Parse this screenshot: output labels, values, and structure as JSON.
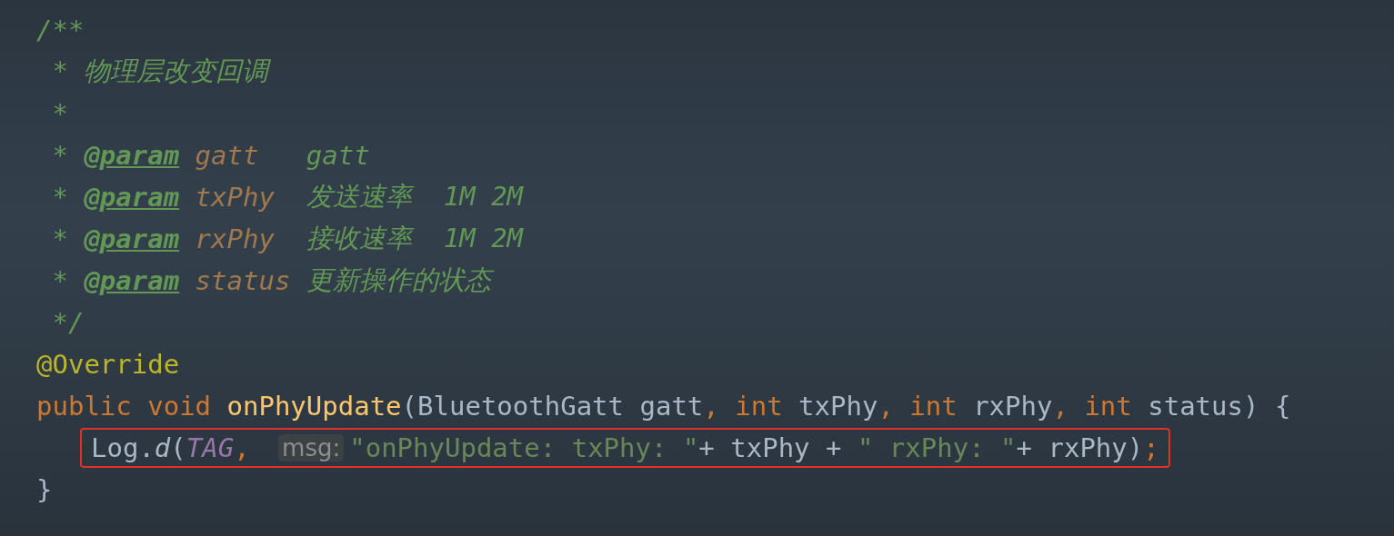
{
  "editor": {
    "lines": [
      {
        "highlighted": false,
        "tokens": [
          {
            "kind": "comment",
            "text": "/**"
          }
        ]
      },
      {
        "highlighted": false,
        "tokens": [
          {
            "kind": "comment",
            "text": " * 物理层改变回调"
          }
        ]
      },
      {
        "highlighted": false,
        "tokens": [
          {
            "kind": "comment",
            "text": " *"
          }
        ]
      },
      {
        "highlighted": false,
        "tokens": [
          {
            "kind": "comment",
            "text": " * "
          },
          {
            "kind": "doc-tag",
            "text": "@param"
          },
          {
            "kind": "doc-param",
            "text": " gatt   "
          },
          {
            "kind": "comment",
            "text": "gatt"
          }
        ]
      },
      {
        "highlighted": false,
        "tokens": [
          {
            "kind": "comment",
            "text": " * "
          },
          {
            "kind": "doc-tag",
            "text": "@param"
          },
          {
            "kind": "doc-param",
            "text": " txPhy  "
          },
          {
            "kind": "comment",
            "text": "发送速率  1M 2M"
          }
        ]
      },
      {
        "highlighted": false,
        "tokens": [
          {
            "kind": "comment",
            "text": " * "
          },
          {
            "kind": "doc-tag",
            "text": "@param"
          },
          {
            "kind": "doc-param",
            "text": " rxPhy  "
          },
          {
            "kind": "comment",
            "text": "接收速率  1M 2M"
          }
        ]
      },
      {
        "highlighted": false,
        "tokens": [
          {
            "kind": "comment",
            "text": " * "
          },
          {
            "kind": "doc-tag",
            "text": "@param"
          },
          {
            "kind": "doc-param",
            "text": " status "
          },
          {
            "kind": "comment",
            "text": "更新操作的状态"
          }
        ]
      },
      {
        "highlighted": false,
        "tokens": [
          {
            "kind": "comment",
            "text": " */"
          }
        ]
      },
      {
        "highlighted": false,
        "tokens": [
          {
            "kind": "annotation",
            "text": "@Override"
          }
        ]
      },
      {
        "highlighted": false,
        "tokens": [
          {
            "kind": "keyword",
            "text": "public void "
          },
          {
            "kind": "method",
            "text": "onPhyUpdate"
          },
          {
            "kind": "plain",
            "text": "(BluetoothGatt gatt"
          },
          {
            "kind": "keyword",
            "text": ", int "
          },
          {
            "kind": "plain",
            "text": "txPhy"
          },
          {
            "kind": "keyword",
            "text": ", int "
          },
          {
            "kind": "plain",
            "text": "rxPhy"
          },
          {
            "kind": "keyword",
            "text": ", int "
          },
          {
            "kind": "plain",
            "text": "status) {"
          }
        ],
        "children": [
          {
            "highlighted": true,
            "tokens": [
              {
                "kind": "plain",
                "text": "Log."
              },
              {
                "kind": "static",
                "text": "d"
              },
              {
                "kind": "plain",
                "text": "("
              },
              {
                "kind": "constant",
                "text": "TAG"
              },
              {
                "kind": "keyword",
                "text": ", "
              },
              {
                "kind": "hint",
                "text": "msg:"
              },
              {
                "kind": "string",
                "text": "\"onPhyUpdate: txPhy: \""
              },
              {
                "kind": "plain",
                "text": "+ txPhy + "
              },
              {
                "kind": "string",
                "text": "\" rxPhy: \""
              },
              {
                "kind": "plain",
                "text": "+ rxPhy)"
              },
              {
                "kind": "keyword",
                "text": ";"
              }
            ]
          }
        ]
      },
      {
        "highlighted": false,
        "tokens": [
          {
            "kind": "plain",
            "text": "}"
          }
        ]
      }
    ]
  }
}
